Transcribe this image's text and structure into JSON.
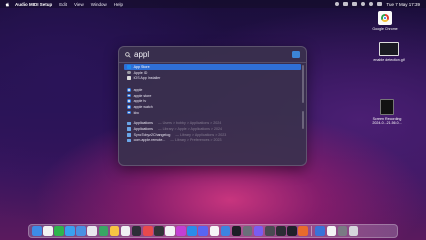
{
  "menubar": {
    "app_name": "Audio MIDI Setup",
    "items": [
      "Edit",
      "View",
      "Window",
      "Help"
    ],
    "clock": "Tue 7 May 17:39"
  },
  "desktop": {
    "items": [
      {
        "label": "Google Chrome",
        "icon": "chrome-file-icon"
      },
      {
        "label": "enable detection.gif",
        "icon": "screen-file-icon"
      },
      {
        "label": "Screen Recording 2024-0...21.56.0...",
        "icon": "video-file-icon"
      }
    ]
  },
  "spotlight": {
    "query": "appl",
    "top_results": [
      {
        "label": "App Store",
        "selected": true,
        "icon": "appstore"
      },
      {
        "label": "Apple ID",
        "selected": false,
        "icon": "appleid"
      },
      {
        "label": "iOS App Installer",
        "selected": false,
        "icon": "ios"
      }
    ],
    "suggestions": [
      {
        "label": "apple",
        "icon": "safari"
      },
      {
        "label": "apple store",
        "icon": "safari"
      },
      {
        "label": "apple tv",
        "icon": "safari"
      },
      {
        "label": "apple watch",
        "icon": "safari"
      },
      {
        "label": "kbc",
        "icon": "safari"
      }
    ],
    "documents": [
      {
        "label": "Applications",
        "sub": "— Users > bobby > Applications > 2024",
        "icon": "folder"
      },
      {
        "label": "Applications",
        "sub": "— Library > Apple > Applications > 2024",
        "icon": "folder"
      },
      {
        "label": "SyncTobyz2Changelog",
        "sub": "— Library > Applications > 2023",
        "icon": "folder"
      },
      {
        "label": "com.apple.remote...",
        "sub": "— Library > Preferences > 2023",
        "icon": "folder"
      }
    ]
  },
  "dock": {
    "apps": [
      "#3d8be6",
      "#f2f2f2",
      "#2fb44d",
      "#3aa0f0",
      "#4a90e2",
      "#e8e8ee",
      "#3aa564",
      "#f6c443",
      "#f0f0f3",
      "#2e2e38",
      "#e8494d",
      "#333338",
      "#f3f3f5",
      "#c33fd4",
      "#2b8be8",
      "#5865f2",
      "#f5f5f7",
      "#3d84e0",
      "#1e1e26",
      "#6b6f7a",
      "#7b5cf0",
      "#4a4a52",
      "#2c2c34",
      "#20202a",
      "#e86b2c",
      "#3a72d8",
      "#f4f4f6",
      "#7a7a84",
      "#d6d6dc"
    ],
    "separator_after": 24
  }
}
